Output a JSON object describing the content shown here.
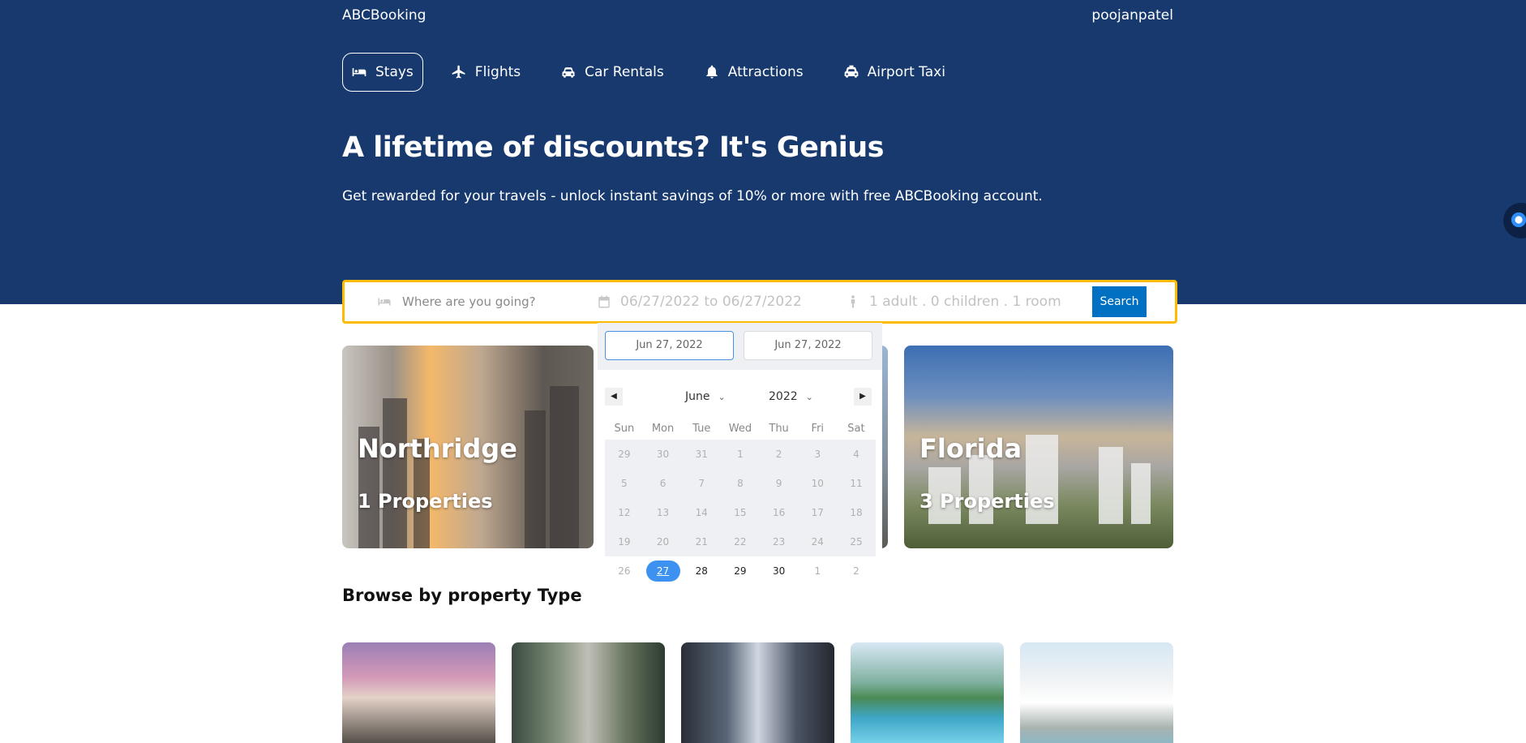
{
  "header": {
    "brand": "ABCBooking",
    "username": "poojanpatel"
  },
  "nav": {
    "items": [
      {
        "label": "Stays",
        "icon": "bed-icon",
        "active": true
      },
      {
        "label": "Flights",
        "icon": "plane-icon"
      },
      {
        "label": "Car Rentals",
        "icon": "car-icon"
      },
      {
        "label": "Attractions",
        "icon": "bell-icon"
      },
      {
        "label": "Airport Taxi",
        "icon": "taxi-icon"
      }
    ]
  },
  "hero": {
    "title": "A lifetime of discounts? It's Genius",
    "subtitle": "Get rewarded for your travels - unlock instant savings of 10% or more with free ABCBooking account."
  },
  "search": {
    "destination_placeholder": "Where are you going?",
    "date_range": "06/27/2022 to 06/27/2022",
    "guests": "1 adult . 0 children . 1 room",
    "button": "Search"
  },
  "featured": [
    {
      "city": "Northridge",
      "count": "1 Properties"
    },
    {
      "city": "Florida",
      "count": "3 Properties"
    }
  ],
  "browse_title": "Browse by property Type",
  "datepicker": {
    "start": "Jun 27, 2022",
    "end": "Jun 27, 2022",
    "month": "June",
    "year": "2022",
    "weekdays": [
      "Sun",
      "Mon",
      "Tue",
      "Wed",
      "Thu",
      "Fri",
      "Sat"
    ],
    "weeks": [
      [
        "29",
        "30",
        "31",
        "1",
        "2",
        "3",
        "4"
      ],
      [
        "5",
        "6",
        "7",
        "8",
        "9",
        "10",
        "11"
      ],
      [
        "12",
        "13",
        "14",
        "15",
        "16",
        "17",
        "18"
      ],
      [
        "19",
        "20",
        "21",
        "22",
        "23",
        "24",
        "25"
      ],
      [
        "26",
        "27",
        "28",
        "29",
        "30",
        "1",
        "2"
      ]
    ],
    "selected": "27"
  },
  "colors": {
    "hero_bg": "#17396e",
    "accent": "#febb02",
    "button": "#0071c2",
    "selected_day": "#3d91f0"
  }
}
